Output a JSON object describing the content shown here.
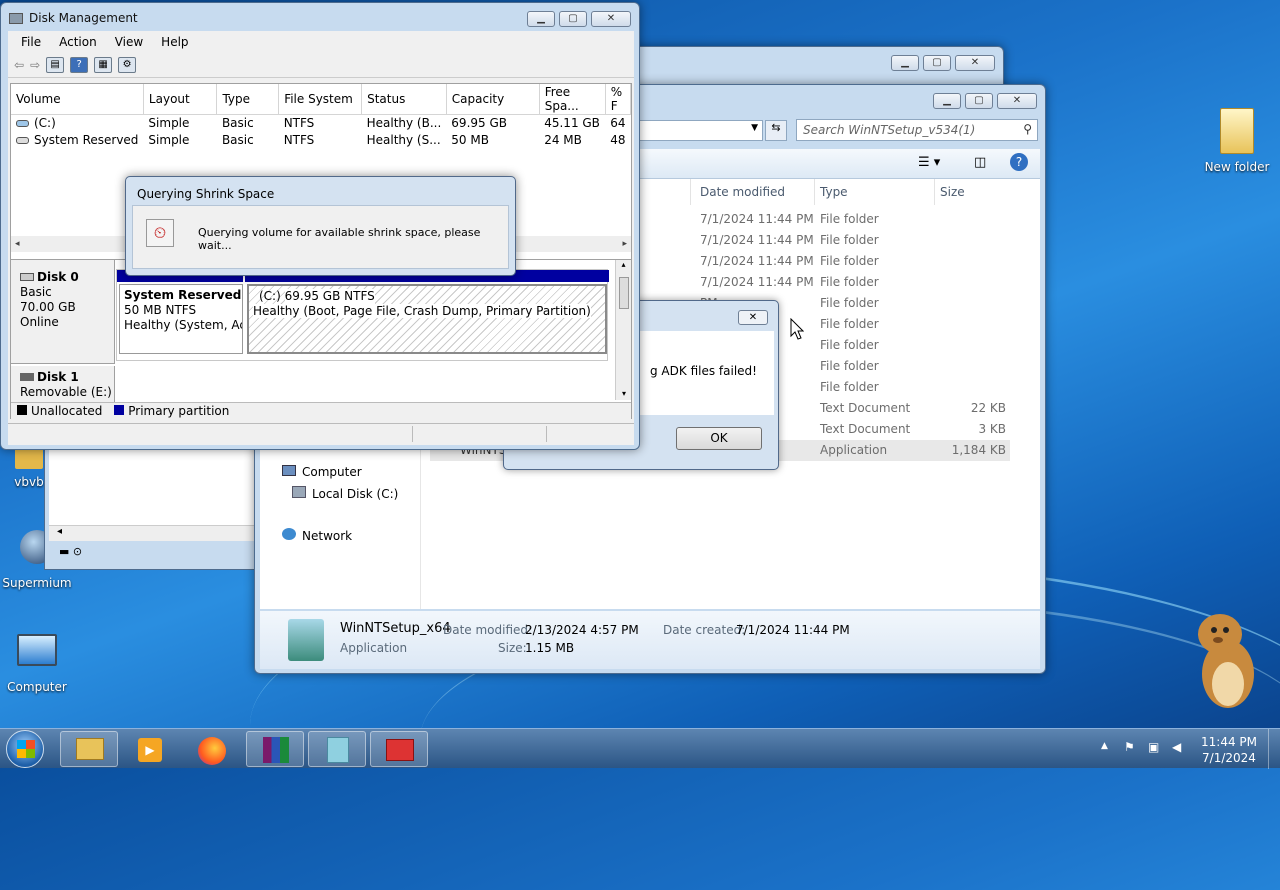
{
  "desktop": {
    "icons": [
      {
        "label": "New folder"
      },
      {
        "label": "vbvb"
      },
      {
        "label": "Supermium"
      },
      {
        "label": "Computer"
      }
    ]
  },
  "disk_mgmt": {
    "title": "Disk Management",
    "menu": [
      "File",
      "Action",
      "View",
      "Help"
    ],
    "columns": [
      "Volume",
      "Layout",
      "Type",
      "File System",
      "Status",
      "Capacity",
      "Free Spa...",
      "% F"
    ],
    "rows": [
      [
        "(C:)",
        "Simple",
        "Basic",
        "NTFS",
        "Healthy (B...",
        "69.95 GB",
        "45.11 GB",
        "64"
      ],
      [
        "System Reserved",
        "Simple",
        "Basic",
        "NTFS",
        "Healthy (S...",
        "50 MB",
        "24 MB",
        "48"
      ]
    ],
    "disk0": {
      "name": "Disk 0",
      "type": "Basic",
      "size": "70.00 GB",
      "state": "Online"
    },
    "disk1": {
      "name": "Disk 1",
      "type": "Removable (E:)"
    },
    "part_sys": {
      "name": "System Reserved",
      "size": "50 MB NTFS",
      "status": "Healthy (System, Acti"
    },
    "part_c": {
      "name": "(C:)",
      "size": "69.95 GB NTFS",
      "status": "Healthy (Boot, Page File, Crash Dump, Primary Partition)"
    },
    "legend": [
      "Unallocated",
      "Primary partition"
    ]
  },
  "shrink_dialog": {
    "title": "Querying Shrink Space",
    "message": "Querying volume for available shrink space, please wait..."
  },
  "error_dialog": {
    "message": "g ADK files failed!",
    "ok": "OK"
  },
  "explorer": {
    "search_placeholder": "Search WinNTSetup_v534(1)",
    "columns": [
      "Date modified",
      "Type",
      "Size"
    ],
    "rows": [
      {
        "date": "7/1/2024 11:44 PM",
        "type": "File folder",
        "size": ""
      },
      {
        "date": "7/1/2024 11:44 PM",
        "type": "File folder",
        "size": ""
      },
      {
        "date": "7/1/2024 11:44 PM",
        "type": "File folder",
        "size": ""
      },
      {
        "date": "7/1/2024 11:44 PM",
        "type": "File folder",
        "size": ""
      },
      {
        "date": "PM",
        "type": "File folder",
        "size": ""
      },
      {
        "date": "",
        "type": "File folder",
        "size": ""
      },
      {
        "date": "",
        "type": "File folder",
        "size": ""
      },
      {
        "date": "",
        "type": "File folder",
        "size": ""
      },
      {
        "date": "",
        "type": "File folder",
        "size": ""
      },
      {
        "date": "",
        "type": "Text Document",
        "size": "22 KB"
      },
      {
        "date": "M",
        "type": "Text Document",
        "size": "3 KB"
      },
      {
        "date": "PM",
        "type": "Application",
        "size": "1,184 KB"
      }
    ],
    "partial_name": "WinNTS",
    "nav": {
      "computer": "Computer",
      "local_disk": "Local Disk (C:)",
      "network": "Network"
    },
    "details": {
      "name": "WinNTSetup_x64",
      "kind": "Application",
      "modified_label": "Date modified:",
      "modified": "2/13/2024 4:57 PM",
      "created_label": "Date created:",
      "created": "7/1/2024 11:44 PM",
      "size_label": "Size:",
      "size": "1.15 MB"
    }
  },
  "taskbar": {
    "time": "11:44 PM",
    "date": "7/1/2024"
  }
}
